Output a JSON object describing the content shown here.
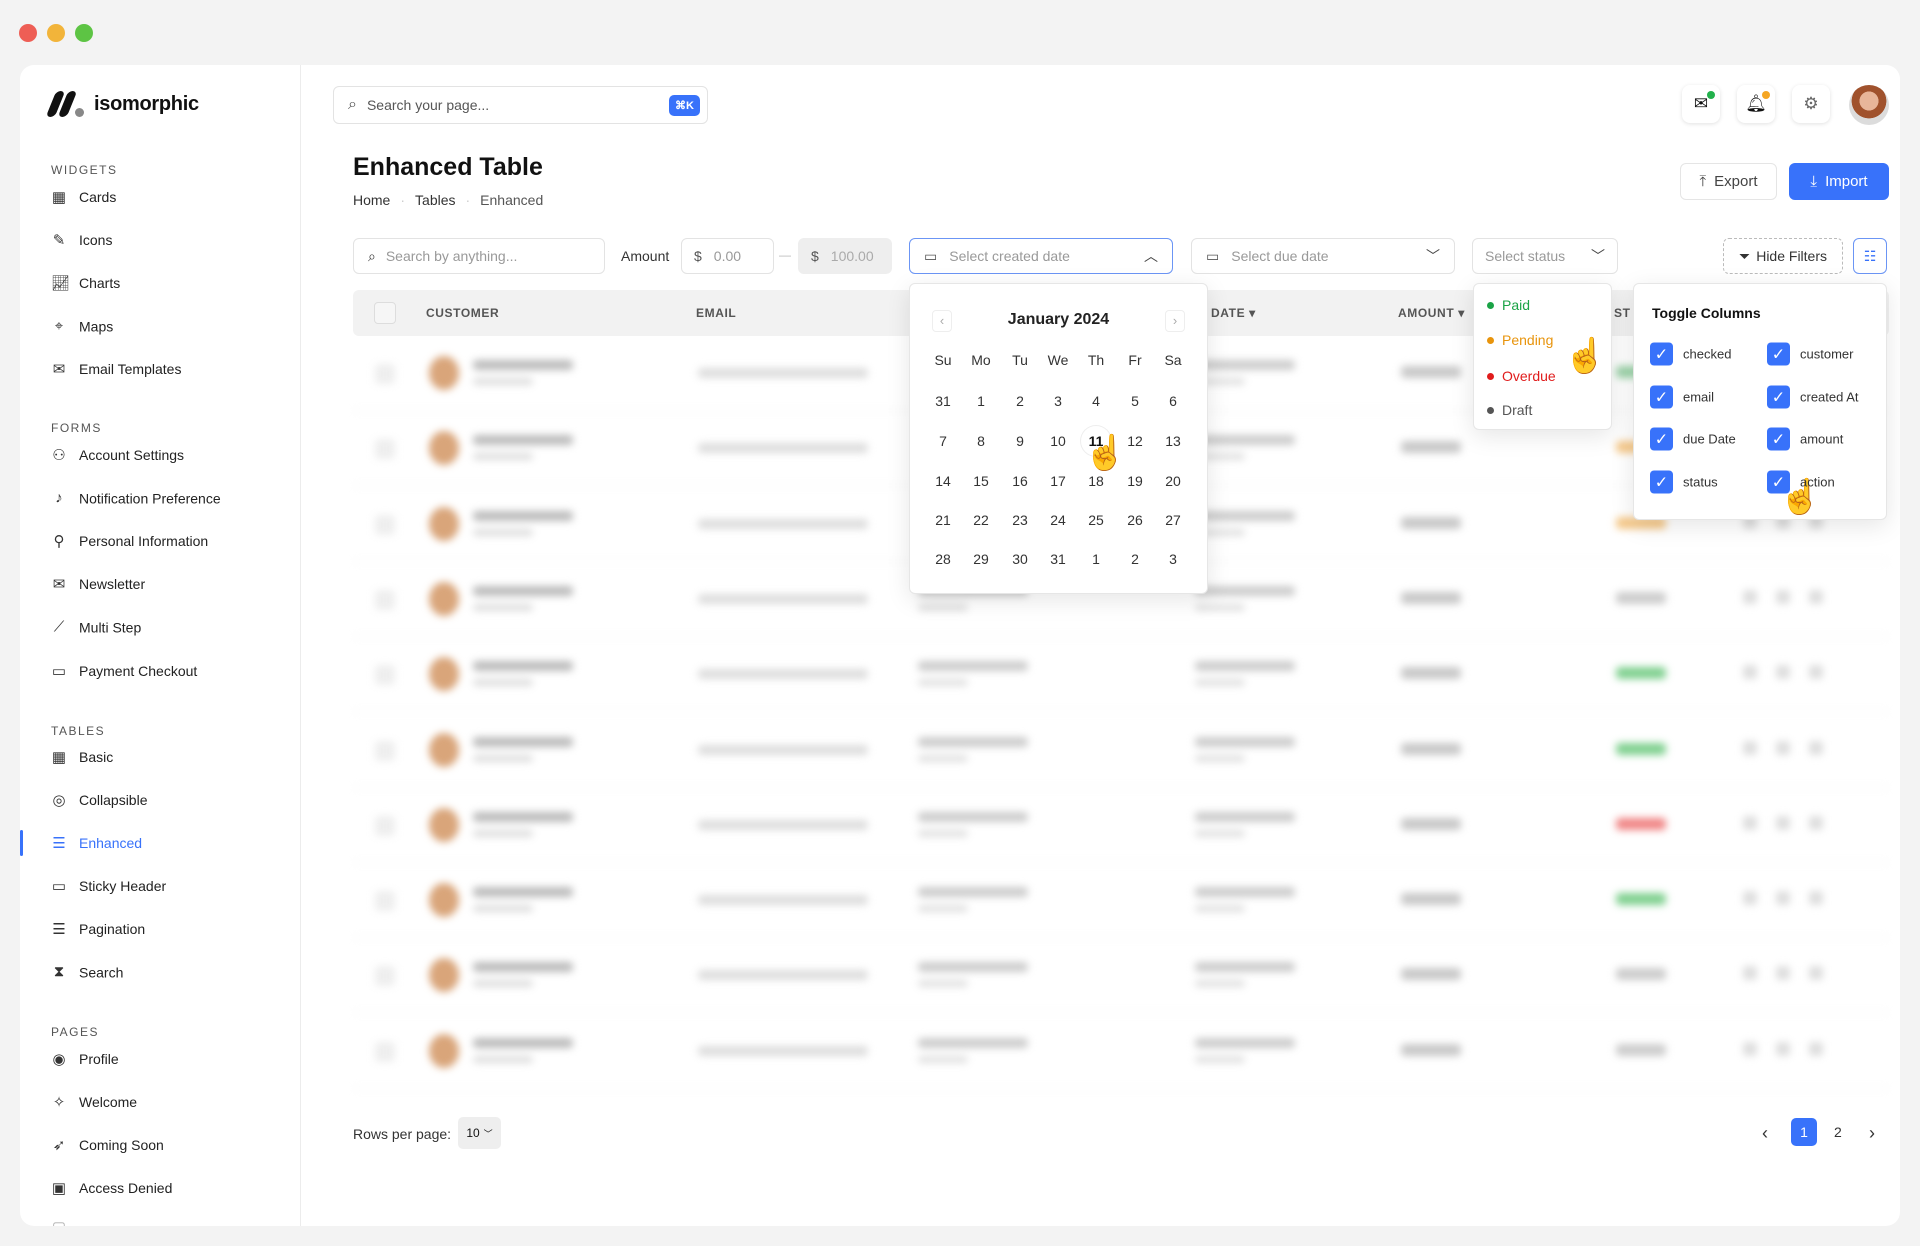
{
  "window_controls": {
    "colors": [
      "#ee5e55",
      "#f2b43a",
      "#5dc444"
    ]
  },
  "brand": {
    "name": "isomorphic"
  },
  "sidebar": {
    "sections": [
      {
        "label": "WIDGETS",
        "items": [
          {
            "label": "Cards",
            "icon": "grid-icon"
          },
          {
            "label": "Icons",
            "icon": "feather-icon"
          },
          {
            "label": "Charts",
            "icon": "chart-icon"
          },
          {
            "label": "Maps",
            "icon": "map-pin-icon"
          },
          {
            "label": "Email Templates",
            "icon": "mail-icon"
          }
        ]
      },
      {
        "label": "FORMS",
        "items": [
          {
            "label": "Account Settings",
            "icon": "user-gear-icon"
          },
          {
            "label": "Notification Preference",
            "icon": "bell-icon"
          },
          {
            "label": "Personal Information",
            "icon": "user-icon"
          },
          {
            "label": "Newsletter",
            "icon": "envelope-open-icon"
          },
          {
            "label": "Multi Step",
            "icon": "steps-icon"
          },
          {
            "label": "Payment Checkout",
            "icon": "credit-card-icon"
          }
        ]
      },
      {
        "label": "TABLES",
        "items": [
          {
            "label": "Basic",
            "icon": "table-icon"
          },
          {
            "label": "Collapsible",
            "icon": "collapse-icon"
          },
          {
            "label": "Enhanced",
            "icon": "table-list-icon",
            "active": true
          },
          {
            "label": "Sticky Header",
            "icon": "window-icon"
          },
          {
            "label": "Pagination",
            "icon": "list-ordered-icon"
          },
          {
            "label": "Search",
            "icon": "hourglass-icon"
          }
        ]
      },
      {
        "label": "PAGES",
        "items": [
          {
            "label": "Profile",
            "icon": "profile-icon"
          },
          {
            "label": "Welcome",
            "icon": "sparkle-icon"
          },
          {
            "label": "Coming Soon",
            "icon": "rocket-icon"
          },
          {
            "label": "Access Denied",
            "icon": "folder-lock-icon"
          }
        ]
      }
    ]
  },
  "header": {
    "search_placeholder": "Search your page...",
    "shortcut": "⌘K",
    "accent": "#3872fa",
    "mail_badge": "#22b14c",
    "bell_badge": "#f5a623"
  },
  "page": {
    "title": "Enhanced Table",
    "breadcrumb": [
      "Home",
      "Tables",
      "Enhanced"
    ],
    "export_label": "Export",
    "import_label": "Import"
  },
  "filters": {
    "search_placeholder": "Search by anything...",
    "amount_label": "Amount",
    "amount_min_placeholder": "0.00",
    "amount_max_placeholder": "100.00",
    "currency": "$",
    "dash": "—",
    "created_placeholder": "Select created date",
    "due_placeholder": "Select due date",
    "status_placeholder": "Select status",
    "hide_filters_label": "Hide Filters"
  },
  "table": {
    "headers": {
      "customer": "CUSTOMER",
      "email": "EMAIL",
      "date": "DATE ▾",
      "amount": "AMOUNT ▾",
      "status": "ST"
    },
    "row_status_colors": [
      "#9bd3a8",
      "#f6c98a",
      "#f6c98a",
      "#cccccc",
      "#7fd08f",
      "#7fd08f",
      "#f08585",
      "#7fd08f",
      "#cccccc",
      "#cccccc"
    ]
  },
  "calendar": {
    "month": "January 2024",
    "weekdays": [
      "Su",
      "Mo",
      "Tu",
      "We",
      "Th",
      "Fr",
      "Sa"
    ],
    "weeks": [
      [
        "31",
        "1",
        "2",
        "3",
        "4",
        "5",
        "6"
      ],
      [
        "7",
        "8",
        "9",
        "10",
        "11",
        "12",
        "13"
      ],
      [
        "14",
        "15",
        "16",
        "17",
        "18",
        "19",
        "20"
      ],
      [
        "21",
        "22",
        "23",
        "24",
        "25",
        "26",
        "27"
      ],
      [
        "28",
        "29",
        "30",
        "31",
        "1",
        "2",
        "3"
      ]
    ],
    "today": "11"
  },
  "status_menu": [
    {
      "label": "Paid",
      "color": "#1aa346"
    },
    {
      "label": "Pending",
      "color": "#e8940c"
    },
    {
      "label": "Overdue",
      "color": "#e01c1c"
    },
    {
      "label": "Draft",
      "color": "#555555"
    }
  ],
  "toggle_columns": {
    "title": "Toggle Columns",
    "items": [
      {
        "label": "checked",
        "checked": true
      },
      {
        "label": "customer",
        "checked": true
      },
      {
        "label": "email",
        "checked": true
      },
      {
        "label": "created At",
        "checked": true
      },
      {
        "label": "due Date",
        "checked": true
      },
      {
        "label": "amount",
        "checked": true
      },
      {
        "label": "status",
        "checked": true
      },
      {
        "label": "action",
        "checked": true
      }
    ]
  },
  "pagination": {
    "rows_label": "Rows per page:",
    "rows_value": "10",
    "pages": [
      "1",
      "2"
    ],
    "current": "1"
  }
}
